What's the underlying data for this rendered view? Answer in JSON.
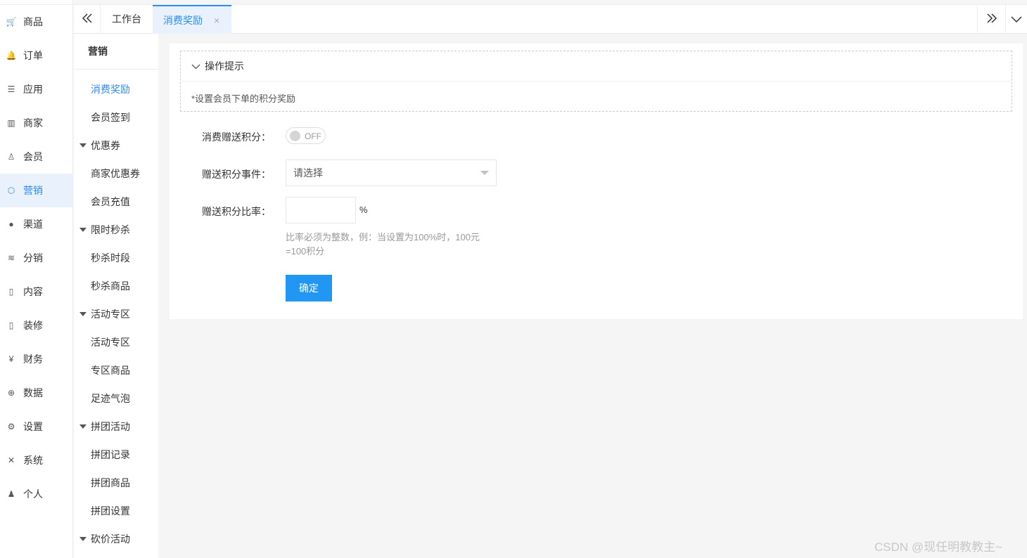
{
  "nav_left": {
    "items": [
      {
        "label": "商品",
        "icon": "cart-icon",
        "glyph": "🛒"
      },
      {
        "label": "订单",
        "icon": "bell-icon",
        "glyph": "🔔"
      },
      {
        "label": "应用",
        "icon": "list-icon",
        "glyph": "☰"
      },
      {
        "label": "商家",
        "icon": "shop-icon",
        "glyph": "▥"
      },
      {
        "label": "会员",
        "icon": "user-icon",
        "glyph": "♙"
      },
      {
        "label": "营销",
        "icon": "cube-icon",
        "glyph": "⬡"
      },
      {
        "label": "渠道",
        "icon": "wechat-icon",
        "glyph": "●"
      },
      {
        "label": "分销",
        "icon": "layers-icon",
        "glyph": "≋"
      },
      {
        "label": "内容",
        "icon": "book-icon",
        "glyph": "▯"
      },
      {
        "label": "装修",
        "icon": "tablet-icon",
        "glyph": "▯"
      },
      {
        "label": "财务",
        "icon": "yen-icon",
        "glyph": "¥"
      },
      {
        "label": "数据",
        "icon": "globe-icon",
        "glyph": "⊕"
      },
      {
        "label": "设置",
        "icon": "gear-icon",
        "glyph": "⚙"
      },
      {
        "label": "系统",
        "icon": "tools-icon",
        "glyph": "✕"
      },
      {
        "label": "个人",
        "icon": "person-icon",
        "glyph": "♟"
      }
    ],
    "active_label": "营销"
  },
  "nav_sub": {
    "title": "营销",
    "items": [
      {
        "label": "消费奖励",
        "type": "item"
      },
      {
        "label": "会员签到",
        "type": "item"
      },
      {
        "label": "优惠券",
        "type": "group"
      },
      {
        "label": "商家优惠券",
        "type": "item"
      },
      {
        "label": "会员充值",
        "type": "item"
      },
      {
        "label": "限时秒杀",
        "type": "group"
      },
      {
        "label": "秒杀时段",
        "type": "item"
      },
      {
        "label": "秒杀商品",
        "type": "item"
      },
      {
        "label": "活动专区",
        "type": "group"
      },
      {
        "label": "活动专区",
        "type": "item"
      },
      {
        "label": "专区商品",
        "type": "item"
      },
      {
        "label": "足迹气泡",
        "type": "item"
      },
      {
        "label": "拼团活动",
        "type": "group"
      },
      {
        "label": "拼团记录",
        "type": "item"
      },
      {
        "label": "拼团商品",
        "type": "item"
      },
      {
        "label": "拼团设置",
        "type": "item"
      },
      {
        "label": "砍价活动",
        "type": "group"
      }
    ]
  },
  "tabs": {
    "prev_glyph": "«",
    "next_glyph": "»",
    "menu_glyph": "⌵",
    "home": "工作台",
    "active": "消费奖励",
    "close_glyph": "×"
  },
  "tips": {
    "title": "操作提示",
    "text": "*设置会员下单的积分奖励"
  },
  "form": {
    "switch_label": "消费赠送积分：",
    "switch_state": "OFF",
    "event_label": "赠送积分事件：",
    "event_placeholder": "请选择",
    "ratio_label": "赠送积分比率：",
    "ratio_value": "",
    "ratio_unit": "%",
    "ratio_hint": "比率必须为整数，例：当设置为100%时，100元=100积分",
    "submit": "确定"
  },
  "colors": {
    "accent": "#2d8cf0",
    "button": "#2196f3",
    "active_bg": "#e8f1fc"
  },
  "watermark": "CSDN @现任明教教主~"
}
